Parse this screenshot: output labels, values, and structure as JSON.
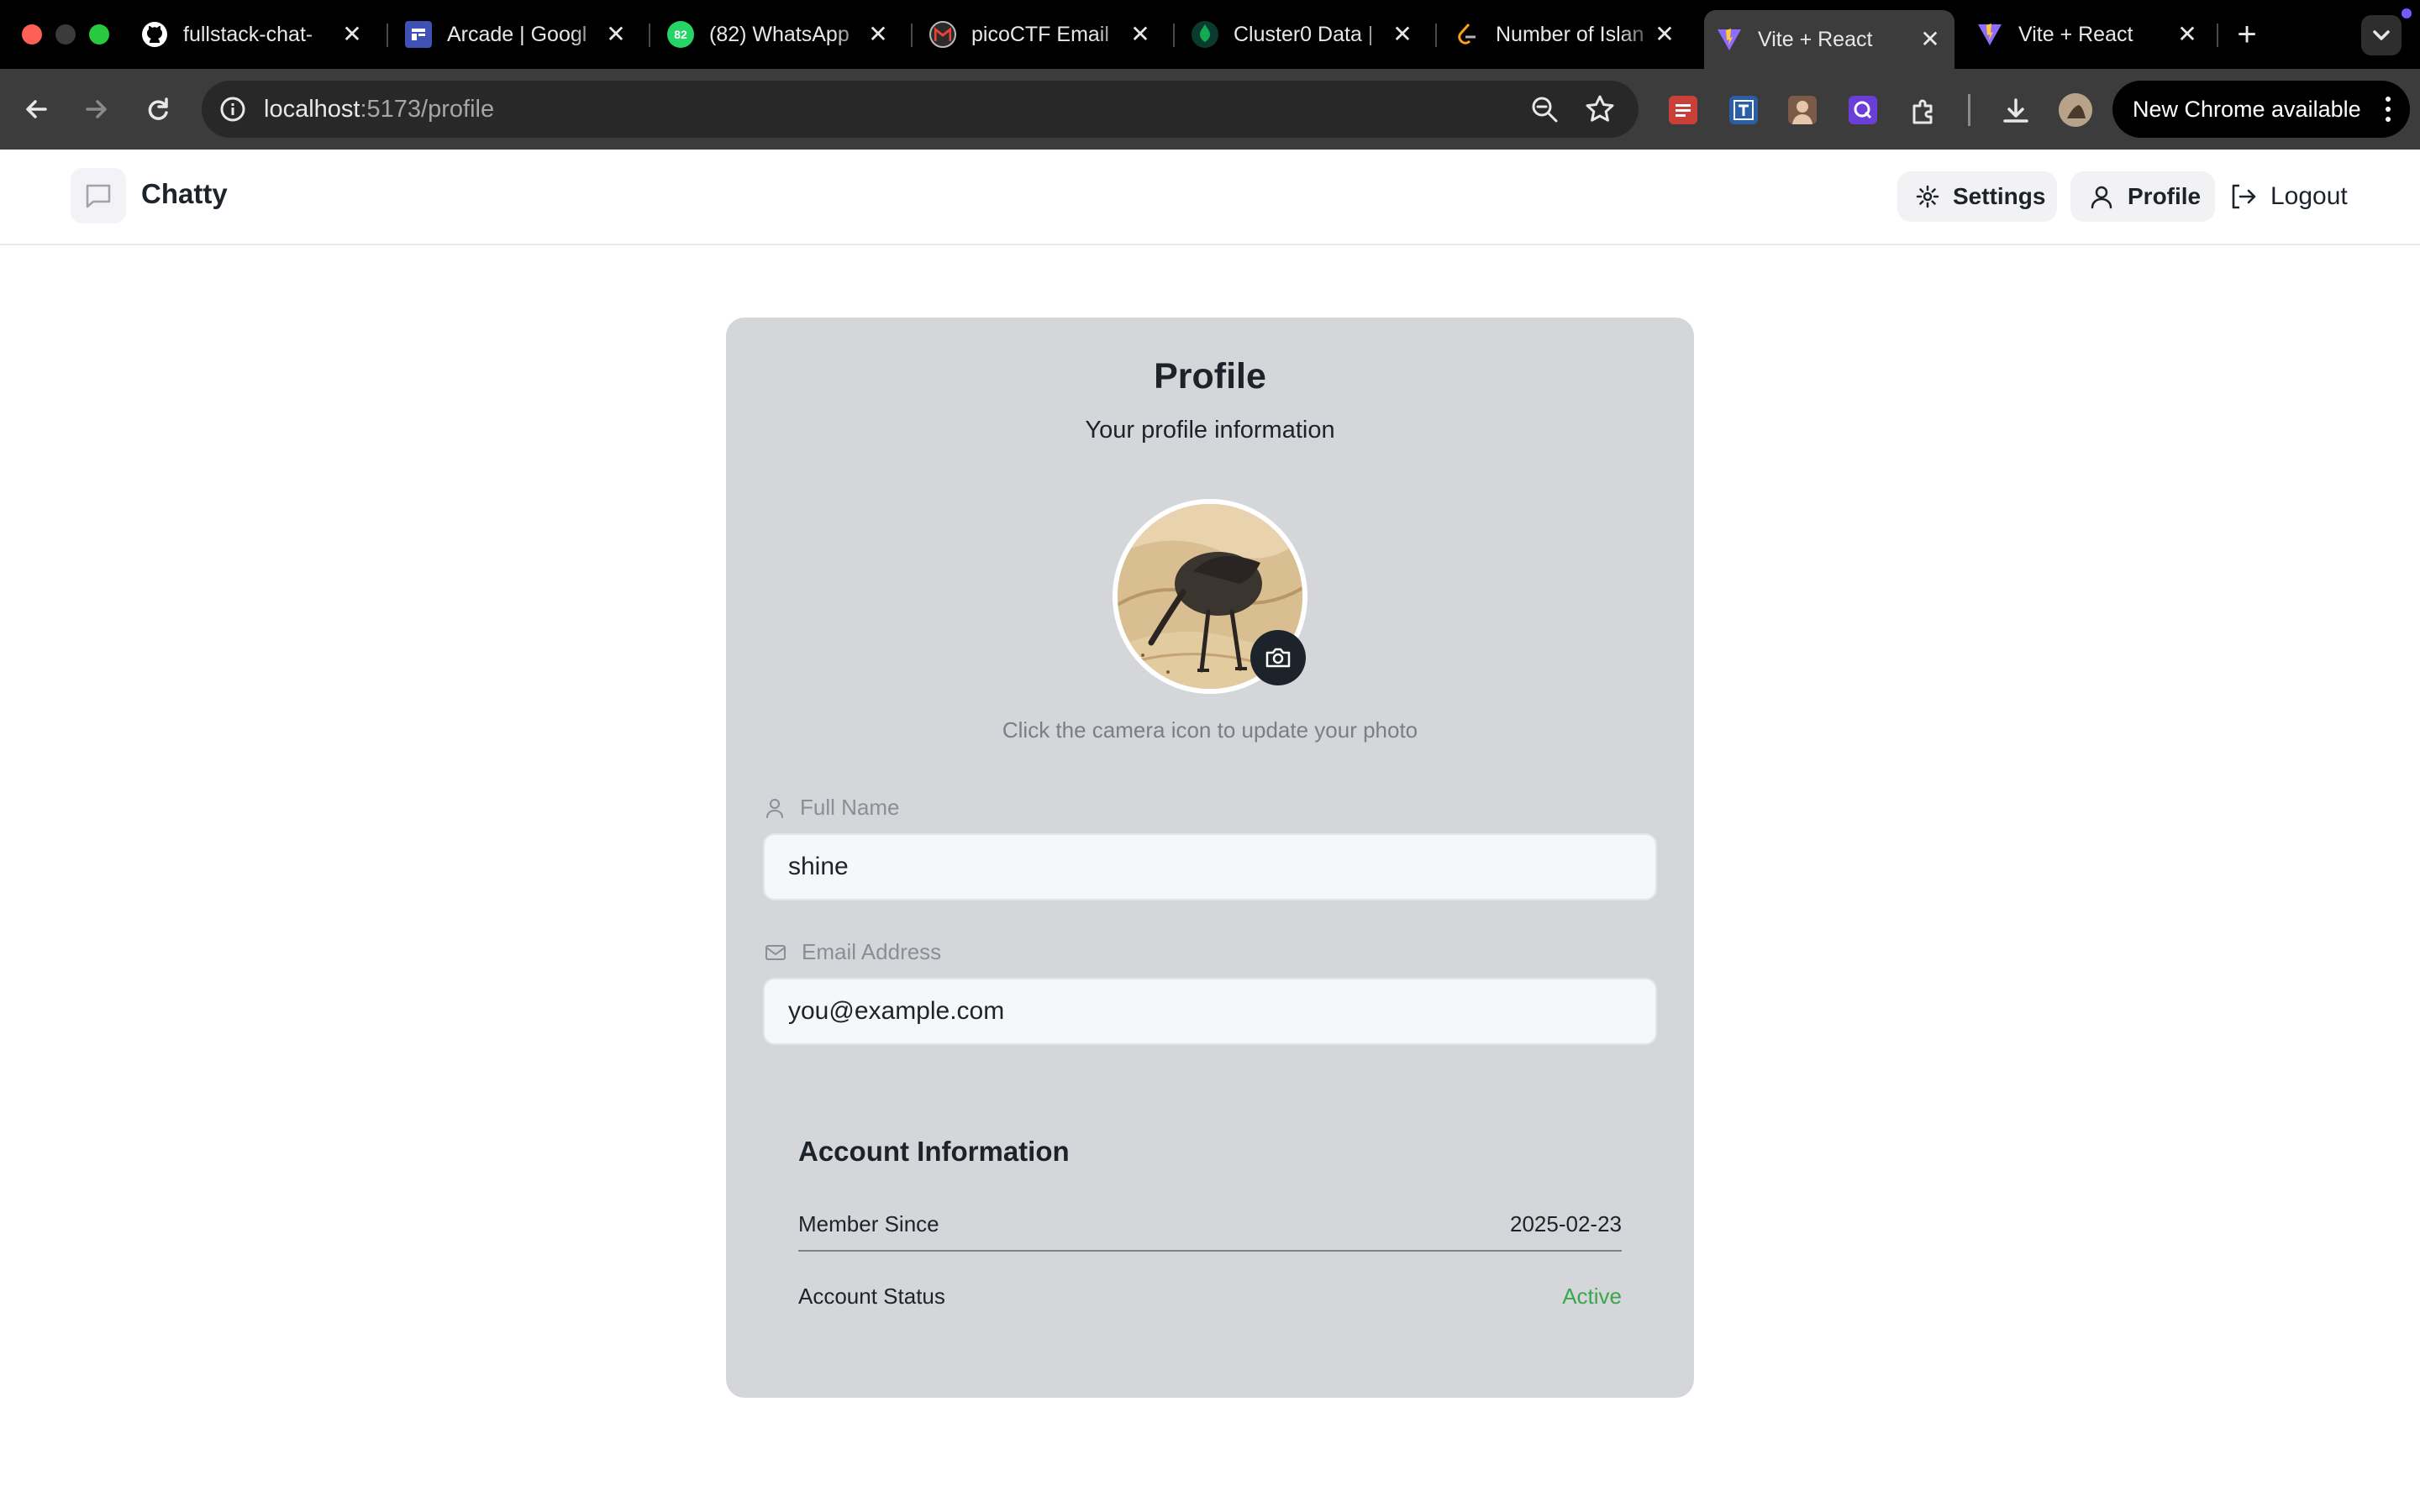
{
  "browser": {
    "tabs": [
      {
        "title": "fullstack-chat-",
        "icon": "github-icon"
      },
      {
        "title": "Arcade | Googl",
        "icon": "arcade-icon"
      },
      {
        "title": "(82) WhatsApp",
        "icon": "whatsapp-icon"
      },
      {
        "title": "picoCTF Email",
        "icon": "gmail-icon"
      },
      {
        "title": "Cluster0 Data |",
        "icon": "mongodb-icon"
      },
      {
        "title": "Number of Islan",
        "icon": "leetcode-icon"
      },
      {
        "title": "Vite + React",
        "icon": "vite-icon"
      },
      {
        "title": "Vite + React",
        "icon": "vite-icon"
      }
    ],
    "active_tab_index": 6,
    "whatsapp_badge": "82",
    "url_host": "localhost",
    "url_path": ":5173/profile",
    "update_label": "New Chrome available"
  },
  "app": {
    "brand": "Chatty",
    "nav": {
      "settings": "Settings",
      "profile": "Profile",
      "logout": "Logout"
    }
  },
  "profile": {
    "title": "Profile",
    "subtitle": "Your profile information",
    "avatar_hint": "Click the camera icon to update your photo",
    "full_name_label": "Full Name",
    "full_name_value": "shine",
    "email_label": "Email Address",
    "email_value": "you@example.com",
    "account": {
      "title": "Account Information",
      "member_since_label": "Member Since",
      "member_since_value": "2025-02-23",
      "status_label": "Account Status",
      "status_value": "Active"
    }
  },
  "colors": {
    "status_active": "#3aa74d",
    "card_bg": "#d4d6da"
  }
}
